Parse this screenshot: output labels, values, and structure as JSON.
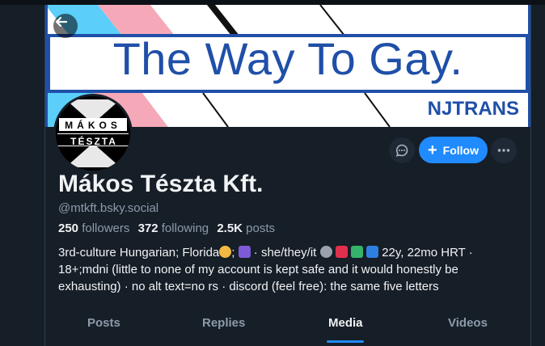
{
  "banner": {
    "title": "The Way To Gay.",
    "logo_text": "NJTRANS",
    "stripe_colors": [
      "#5bcefa",
      "#f5a9b8",
      "#ffffff"
    ]
  },
  "avatar": {
    "line1": "MÁKOS",
    "line2": "TÉSZTA"
  },
  "actions": {
    "message_icon": "chat-bubble-icon",
    "follow_label": "Follow",
    "more_icon": "ellipsis-icon"
  },
  "profile": {
    "display_name": "Mákos Tészta Kft.",
    "handle": "@mtkft.bsky.social",
    "followers_count": "250",
    "followers_label": "followers",
    "following_count": "372",
    "following_label": "following",
    "posts_count": "2.5K",
    "posts_label": "posts",
    "bio_line1_a": "3rd-culture Hungarian; Florida",
    "bio_line1_b": ";",
    "bio_line1_c": "· she/they/it",
    "bio_line1_d": "22y, 22mo HRT ·",
    "bio_line2": "18+;mdni (little to none of my account is kept safe and it would honestly be",
    "bio_line3": "exhausting) · no alt text=no rs · discord (feel free): the same five letters"
  },
  "tabs": [
    {
      "label": "Posts"
    },
    {
      "label": "Replies"
    },
    {
      "label": "Media"
    },
    {
      "label": "Videos"
    }
  ],
  "colors": {
    "accent": "#208bfe",
    "background": "#161e27",
    "muted": "#8d9aab"
  }
}
